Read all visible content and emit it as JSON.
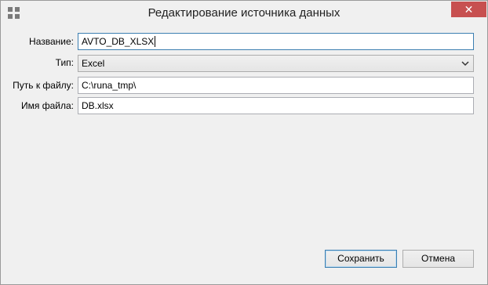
{
  "window": {
    "title": "Редактирование источника данных",
    "close_label": "✕"
  },
  "form": {
    "name_label": "Название:",
    "name_value": "AVTO_DB_XLSX",
    "type_label": "Тип:",
    "type_value": "Excel",
    "path_label": "Путь к файлу:",
    "path_value": "C:\\runa_tmp\\",
    "filename_label": "Имя файла:",
    "filename_value": "DB.xlsx"
  },
  "buttons": {
    "save_label": "Сохранить",
    "cancel_label": "Отмена"
  },
  "icons": {
    "app": "app-grid-icon",
    "close": "close-icon",
    "dropdown": "chevron-down-icon"
  },
  "colors": {
    "close_button": "#c75050",
    "focus_border": "#3c7fb1",
    "window_bg": "#f0f0f0"
  }
}
